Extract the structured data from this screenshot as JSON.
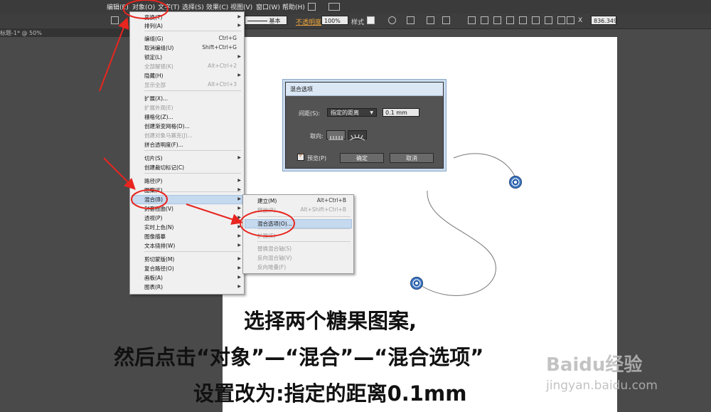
{
  "menubar": {
    "items": [
      "编辑(E)",
      "对象(O)",
      "文字(T)",
      "选择(S)",
      "效果(C)",
      "视图(V)",
      "窗口(W)",
      "帮助(H)"
    ]
  },
  "options_bar": {
    "stroke_label": "基本",
    "opacity_label": "不透明度",
    "opacity_value": "100%",
    "style_label": "样式",
    "x_value": "836.349"
  },
  "document_tab": {
    "label": "标题-1* @ 50%"
  },
  "object_menu": {
    "items": [
      {
        "label": "变换(T)",
        "shortcut": "",
        "submenu": true,
        "disabled": false
      },
      {
        "label": "排列(A)",
        "shortcut": "",
        "submenu": true,
        "disabled": false
      },
      {
        "label": "编组(G)",
        "shortcut": "Ctrl+G",
        "submenu": false,
        "disabled": false
      },
      {
        "label": "取消编组(U)",
        "shortcut": "Shift+Ctrl+G",
        "submenu": false,
        "disabled": false
      },
      {
        "label": "锁定(L)",
        "shortcut": "",
        "submenu": true,
        "disabled": false
      },
      {
        "label": "全部解锁(K)",
        "shortcut": "Alt+Ctrl+2",
        "submenu": false,
        "disabled": true
      },
      {
        "label": "隐藏(H)",
        "shortcut": "",
        "submenu": true,
        "disabled": false
      },
      {
        "label": "显示全部",
        "shortcut": "Alt+Ctrl+3",
        "submenu": false,
        "disabled": true
      },
      {
        "label": "扩展(X)...",
        "shortcut": "",
        "submenu": false,
        "disabled": false
      },
      {
        "label": "扩展外观(E)",
        "shortcut": "",
        "submenu": false,
        "disabled": true
      },
      {
        "label": "栅格化(Z)...",
        "shortcut": "",
        "submenu": false,
        "disabled": false
      },
      {
        "label": "创建渐变网格(D)...",
        "shortcut": "",
        "submenu": false,
        "disabled": false
      },
      {
        "label": "创建对象马赛克(J)...",
        "shortcut": "",
        "submenu": false,
        "disabled": true
      },
      {
        "label": "拼合透明度(F)...",
        "shortcut": "",
        "submenu": false,
        "disabled": false
      },
      {
        "label": "切片(S)",
        "shortcut": "",
        "submenu": true,
        "disabled": false
      },
      {
        "label": "创建裁切标记(C)",
        "shortcut": "",
        "submenu": false,
        "disabled": false
      },
      {
        "label": "路径(P)",
        "shortcut": "",
        "submenu": true,
        "disabled": false
      },
      {
        "label": "图案(E)",
        "shortcut": "",
        "submenu": true,
        "disabled": false
      },
      {
        "label": "混合(B)",
        "shortcut": "",
        "submenu": true,
        "disabled": false
      },
      {
        "label": "封套扭曲(V)",
        "shortcut": "",
        "submenu": true,
        "disabled": false
      },
      {
        "label": "透视(P)",
        "shortcut": "",
        "submenu": true,
        "disabled": false
      },
      {
        "label": "实时上色(N)",
        "shortcut": "",
        "submenu": true,
        "disabled": false
      },
      {
        "label": "图像描摹",
        "shortcut": "",
        "submenu": true,
        "disabled": false
      },
      {
        "label": "文本绕排(W)",
        "shortcut": "",
        "submenu": true,
        "disabled": false
      },
      {
        "label": "剪切蒙版(M)",
        "shortcut": "",
        "submenu": true,
        "disabled": false
      },
      {
        "label": "复合路径(O)",
        "shortcut": "",
        "submenu": true,
        "disabled": false
      },
      {
        "label": "画板(A)",
        "shortcut": "",
        "submenu": true,
        "disabled": false
      },
      {
        "label": "图表(R)",
        "shortcut": "",
        "submenu": true,
        "disabled": false
      }
    ]
  },
  "blend_submenu": {
    "items": [
      {
        "label": "建立(M)",
        "shortcut": "Alt+Ctrl+B",
        "disabled": false
      },
      {
        "label": "释放(R)",
        "shortcut": "Alt+Shift+Ctrl+B",
        "disabled": true
      },
      {
        "label": "混合选项(O)...",
        "shortcut": "",
        "disabled": false
      },
      {
        "label": "扩展(E)",
        "shortcut": "",
        "disabled": true
      },
      {
        "label": "替换混合轴(S)",
        "shortcut": "",
        "disabled": true
      },
      {
        "label": "反向混合轴(V)",
        "shortcut": "",
        "disabled": true
      },
      {
        "label": "反向堆叠(F)",
        "shortcut": "",
        "disabled": true
      }
    ]
  },
  "dialog": {
    "title": "混合选项",
    "spacing_label": "间距(S):",
    "spacing_mode": "指定的距离",
    "spacing_value": "0.1 mm",
    "orientation_label": "取向:",
    "preview_label": "预览(P)",
    "ok_label": "确定",
    "cancel_label": "取消"
  },
  "caption": {
    "line1": "选择两个糖果图案,",
    "line2": "然后点击“对象”—“混合”—“混合选项”",
    "line3": "设置改为:指定的距离0.1mm"
  },
  "watermark": {
    "brand": "Baidu经验",
    "url": "jingyan.baidu.com"
  },
  "colors": {
    "annotation_red": "#e8251f",
    "menu_highlight": "#c5d9ef",
    "candy_blue": "#3f78c4"
  }
}
